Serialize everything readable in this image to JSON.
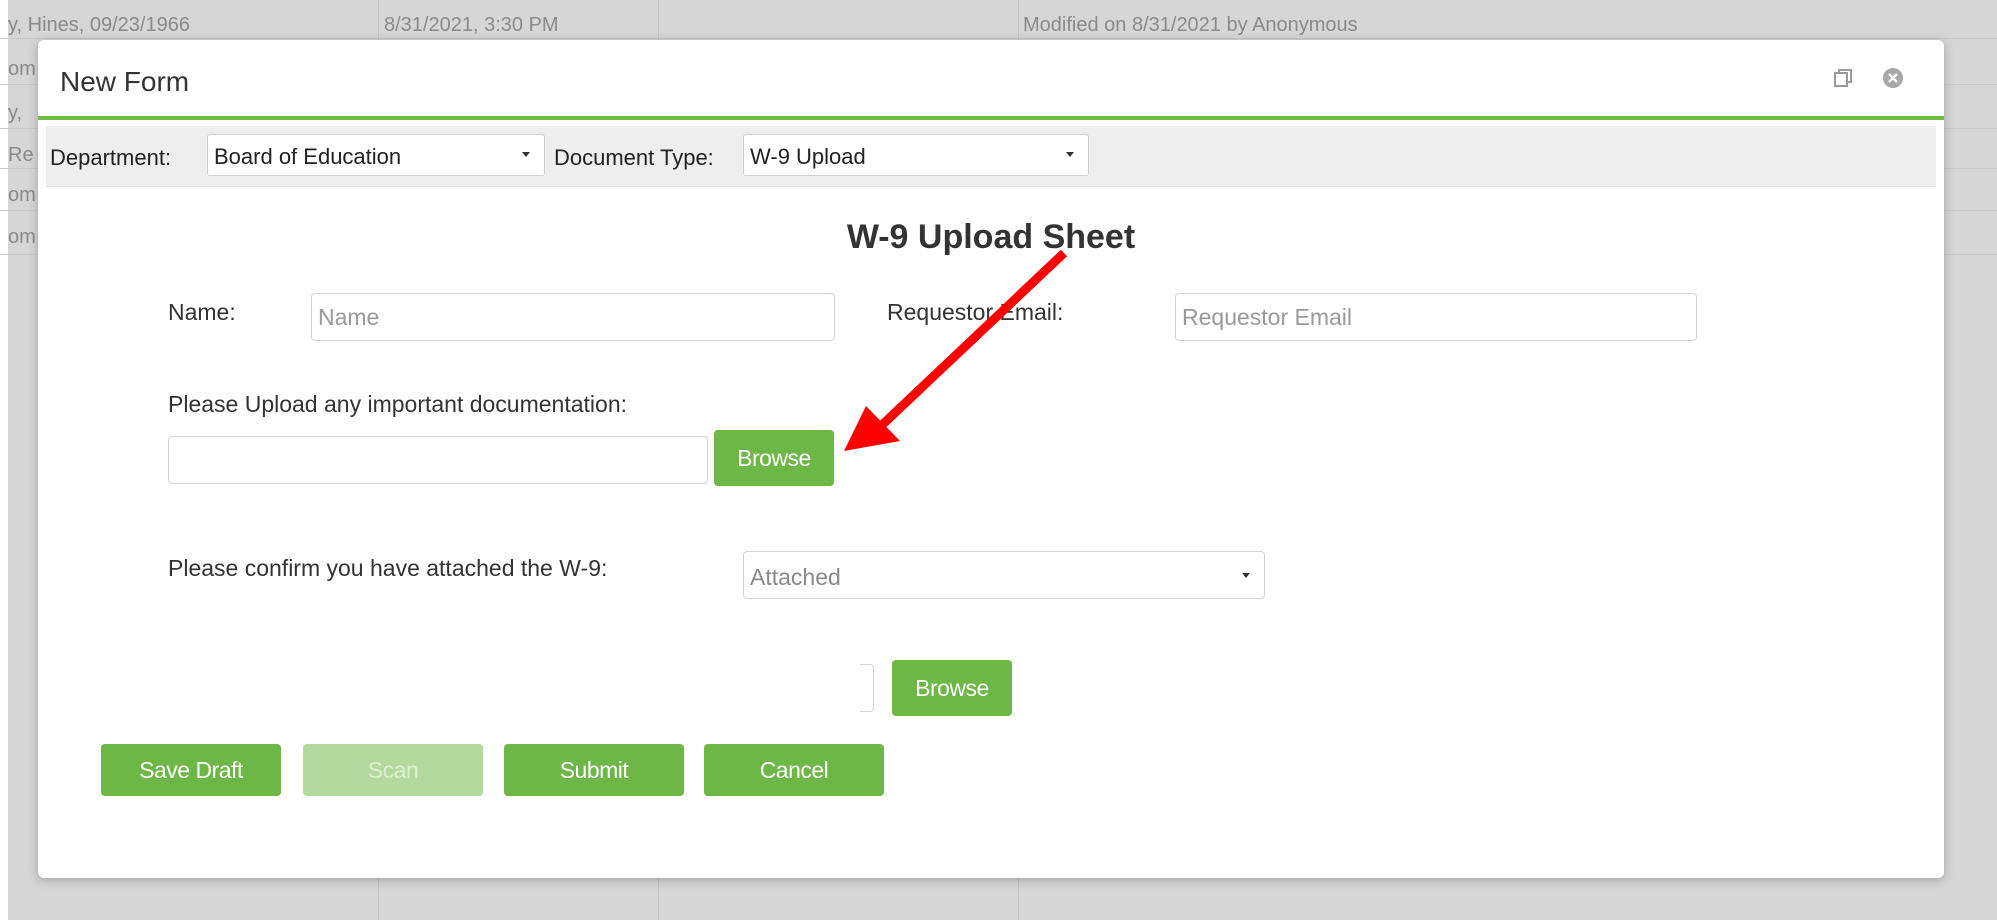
{
  "background": {
    "rows": [
      {
        "name": "y, Hines, 09/23/1966",
        "date": "8/31/2021, 3:30 PM",
        "status": "Modified on 8/31/2021 by Anonymous"
      },
      {
        "name": "om"
      },
      {
        "name": "y,"
      },
      {
        "name": "Re"
      },
      {
        "name": "om"
      },
      {
        "name": "om"
      }
    ]
  },
  "modal": {
    "title": "New Form",
    "restore_icon": "restore-icon",
    "close_icon": "close-icon"
  },
  "toolbar": {
    "department_label": "Department:",
    "department_value": "Board of Education",
    "doctype_label": "Document Type:",
    "doctype_value": "W-9 Upload"
  },
  "form": {
    "title": "W-9 Upload Sheet",
    "name_label": "Name:",
    "name_placeholder": "Name",
    "email_label": "Requestor Email:",
    "email_placeholder": "Requestor Email",
    "upload_label": "Please Upload any important documentation:",
    "browse_label": "Browse",
    "confirm_label": "Please confirm you have attached the W-9:",
    "confirm_value": "Attached",
    "browse2_label": "Browse"
  },
  "actions": {
    "save_draft": "Save Draft",
    "scan": "Scan",
    "submit": "Submit",
    "cancel": "Cancel"
  },
  "colors": {
    "accent_green": "#6cb745",
    "disabled_green": "#b3d99f",
    "annotation_red": "#ff0000"
  }
}
